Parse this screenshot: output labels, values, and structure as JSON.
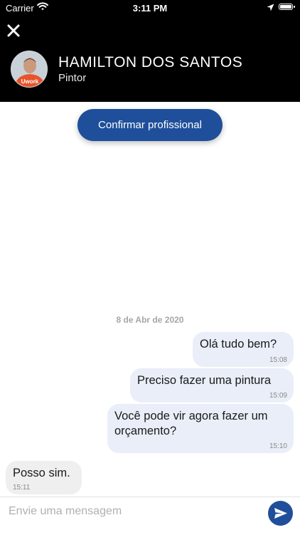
{
  "status_bar": {
    "carrier": "Carrier",
    "time": "3:11 PM"
  },
  "header": {
    "name": "HAMILTON DOS SANTOS",
    "role": "Pintor",
    "avatar_shirt_text": "Uwork"
  },
  "confirm_button": {
    "label": "Confirmar profissional"
  },
  "chat": {
    "date_separator": "8 de Abr de 2020",
    "messages": [
      {
        "direction": "outgoing",
        "text": "Olá tudo bem?",
        "time": "15:08"
      },
      {
        "direction": "outgoing",
        "text": "Preciso fazer uma pintura",
        "time": "15:09"
      },
      {
        "direction": "outgoing",
        "text": "Você pode vir agora fazer um orçamento?",
        "time": "15:10"
      },
      {
        "direction": "incoming",
        "text": "Posso sim.",
        "time": "15:11"
      }
    ]
  },
  "composer": {
    "placeholder": "Envie uma mensagem"
  },
  "colors": {
    "header_bg": "#000000",
    "accent": "#1f4f9a",
    "outgoing_bubble": "#e9eef8",
    "incoming_bubble": "#efefef"
  },
  "icons": [
    "wifi-icon",
    "location-arrow-icon",
    "battery-icon",
    "close-icon",
    "send-icon"
  ]
}
